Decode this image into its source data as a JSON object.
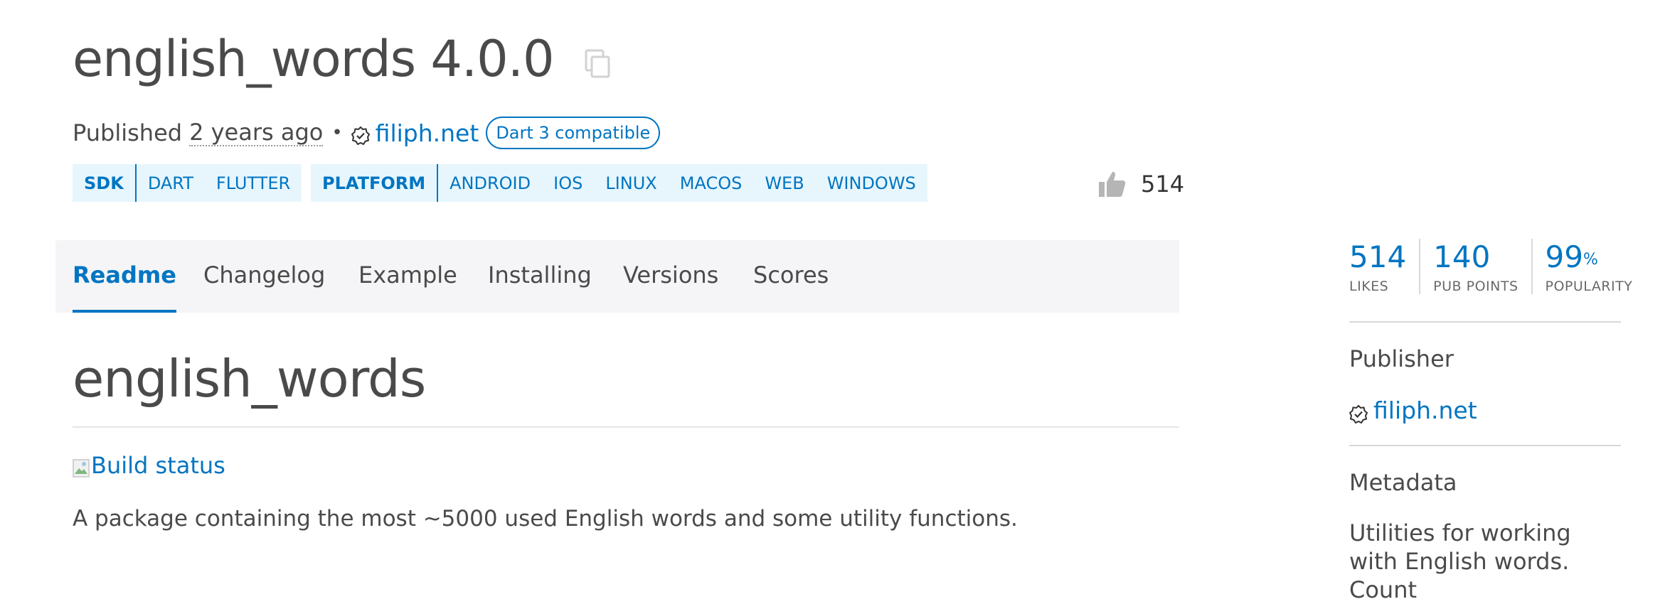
{
  "package": {
    "title": "english_words 4.0.0",
    "copy_icon": "copy-icon"
  },
  "published": {
    "prefix": "Published",
    "ago": "2 years ago",
    "bullet": "•",
    "publisher": "filiph.net",
    "badge": "Dart 3 compatible"
  },
  "tags": {
    "sdk_label": "SDK",
    "sdk_items": [
      "DART",
      "FLUTTER"
    ],
    "platform_label": "PLATFORM",
    "platform_items": [
      "ANDROID",
      "IOS",
      "LINUX",
      "MACOS",
      "WEB",
      "WINDOWS"
    ]
  },
  "likes_inline": "514",
  "tabs": [
    {
      "label": "Readme",
      "active": true
    },
    {
      "label": "Changelog",
      "active": false
    },
    {
      "label": "Example",
      "active": false
    },
    {
      "label": "Installing",
      "active": false
    },
    {
      "label": "Versions",
      "active": false
    },
    {
      "label": "Scores",
      "active": false
    }
  ],
  "readme": {
    "title": "english_words",
    "build_status": "Build status",
    "description": "A package containing the most ~5000 used English words and some utility functions."
  },
  "stats": [
    {
      "value": "514",
      "suffix": "",
      "label": "LIKES"
    },
    {
      "value": "140",
      "suffix": "",
      "label": "PUB POINTS"
    },
    {
      "value": "99",
      "suffix": "%",
      "label": "POPULARITY"
    }
  ],
  "sidebar": {
    "publisher_heading": "Publisher",
    "publisher_link": "filiph.net",
    "metadata_heading": "Metadata",
    "metadata_text": "Utilities for working with English words. Count"
  },
  "colors": {
    "accent": "#0175c2",
    "tag_bg": "#e7f6fd",
    "tabbar_bg": "#f5f5f7",
    "text": "#4a4a4a"
  }
}
